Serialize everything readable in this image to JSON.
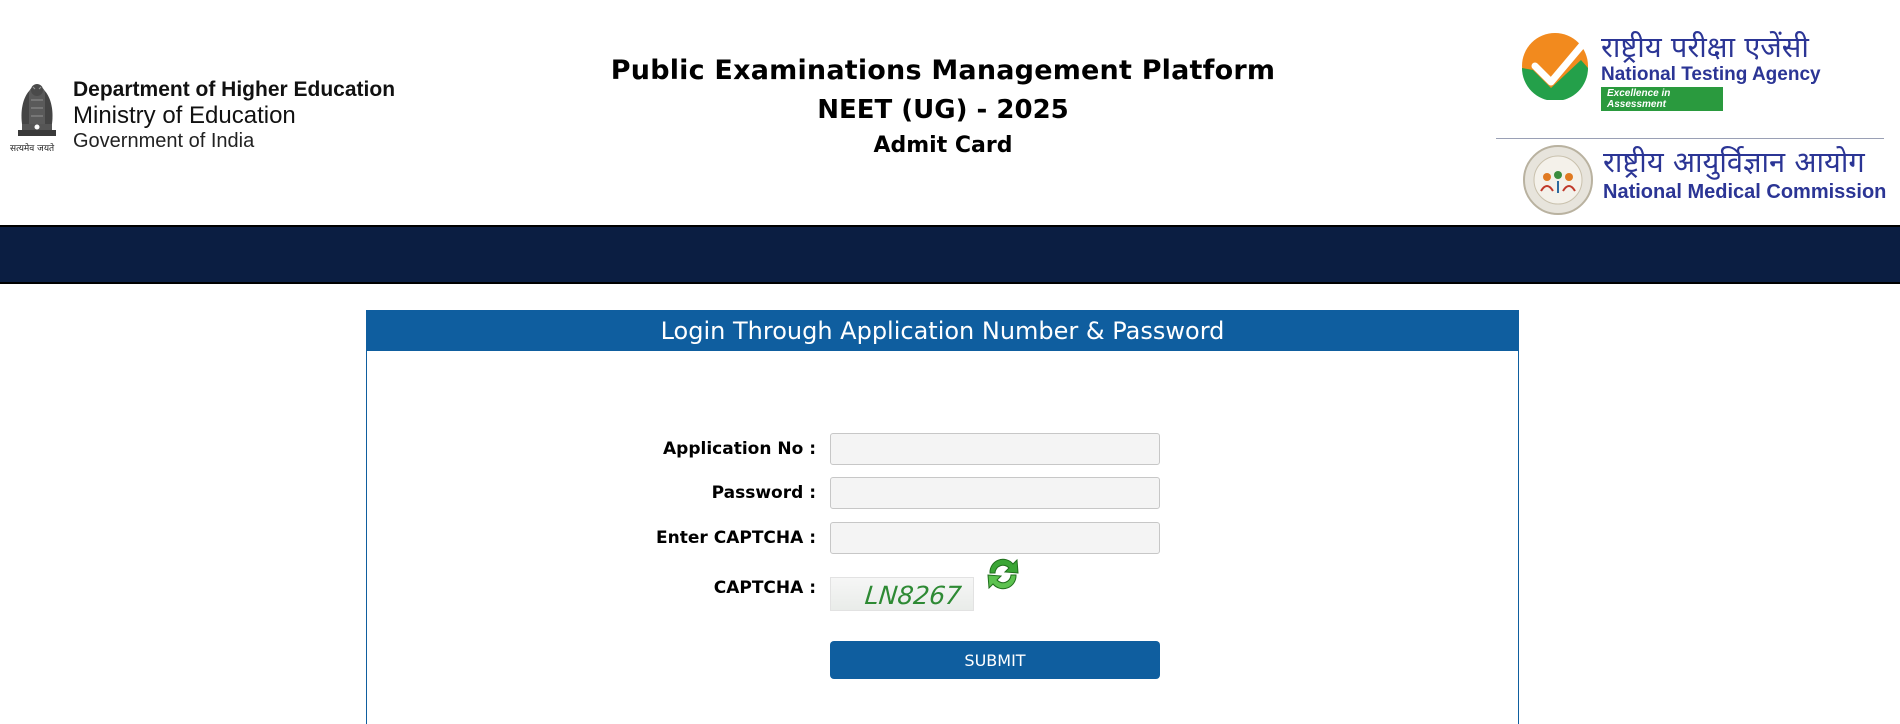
{
  "header": {
    "department": {
      "emblem_motto": "सत्यमेव जयते",
      "line1": "Department of Higher Education",
      "line2": "Ministry of Education",
      "line3": "Government of India"
    },
    "titles": {
      "platform": "Public Examinations Management Platform",
      "exam": "NEET (UG) - 2025",
      "document": "Admit Card"
    },
    "nta": {
      "hindi": "राष्ट्रीय परीक्षा एजेंसी",
      "english": "National Testing Agency",
      "tagline": "Excellence in Assessment",
      "logo_colors": {
        "orange": "#f28a1e",
        "green": "#24a04a"
      }
    },
    "nmc": {
      "hindi": "राष्ट्रीय आयुर्विज्ञान आयोग",
      "english": "National Medical Commission"
    }
  },
  "theme": {
    "navbar": "#0b1e42",
    "primary": "#0f5e9f",
    "brand_text": "#2b3595"
  },
  "login": {
    "heading": "Login Through Application Number & Password",
    "fields": {
      "application_no": {
        "label": "Application No :",
        "value": "",
        "placeholder": ""
      },
      "password": {
        "label": "Password :",
        "value": "",
        "placeholder": ""
      },
      "captcha_input": {
        "label": "Enter CAPTCHA :",
        "value": "",
        "placeholder": ""
      }
    },
    "captcha": {
      "label": "CAPTCHA :",
      "code": "LN8267",
      "refresh_icon": "refresh-icon"
    },
    "submit_label": "SUBMIT"
  }
}
